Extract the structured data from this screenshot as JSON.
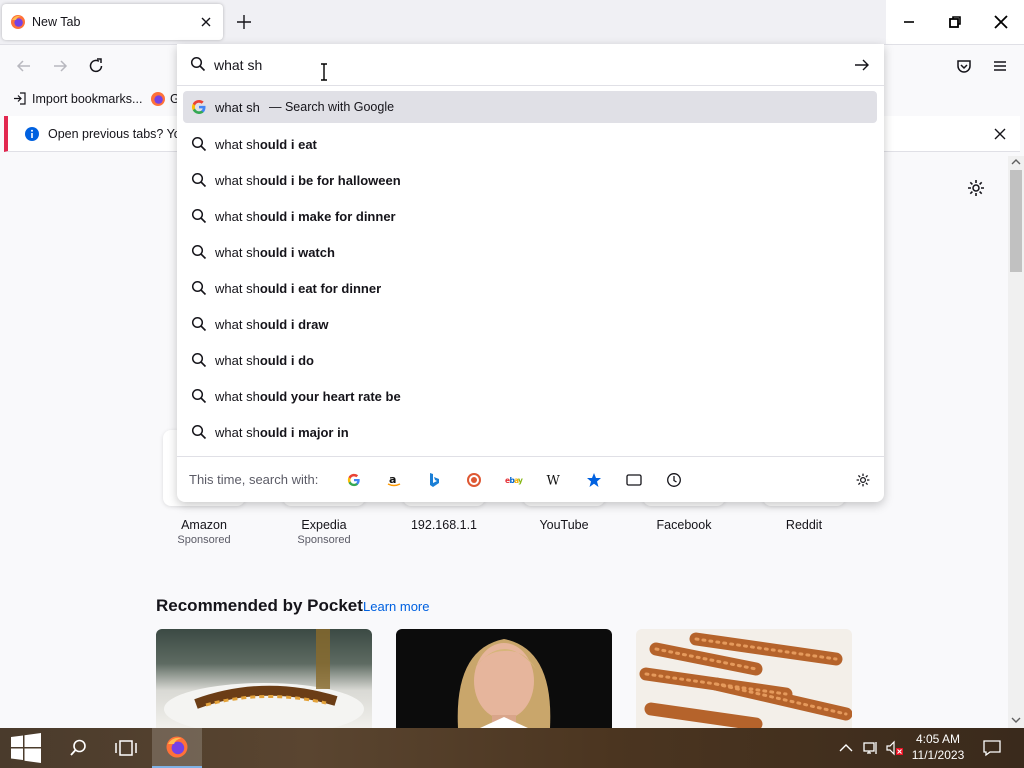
{
  "browser": {
    "tab_title": "New Tab",
    "bookmarks": [
      "Import bookmarks...",
      "G"
    ],
    "notification": "Open previous tabs? You"
  },
  "urlbar": {
    "value": "what sh",
    "google_query": "what sh",
    "google_suffix": "— Search with Google",
    "suggestions": [
      {
        "typed": "what sh",
        "rest": "ould i eat"
      },
      {
        "typed": "what sh",
        "rest": "ould i be for halloween"
      },
      {
        "typed": "what sh",
        "rest": "ould i make for dinner"
      },
      {
        "typed": "what sh",
        "rest": "ould i watch"
      },
      {
        "typed": "what sh",
        "rest": "ould i eat for dinner"
      },
      {
        "typed": "what sh",
        "rest": "ould i draw"
      },
      {
        "typed": "what sh",
        "rest": "ould i do"
      },
      {
        "typed": "what sh",
        "rest": "ould your heart rate be"
      },
      {
        "typed": "what sh",
        "rest": "ould i major in"
      }
    ],
    "search_with_label": "This time, search with:",
    "engines": [
      "google-icon",
      "amazon-icon",
      "bing-icon",
      "duckduckgo-icon",
      "ebay-icon",
      "wikipedia-icon",
      "bookmarks-icon",
      "tabs-icon",
      "history-icon"
    ]
  },
  "shortcuts": [
    {
      "label": "Amazon",
      "sponsored": "Sponsored"
    },
    {
      "label": "Expedia",
      "sponsored": "Sponsored"
    },
    {
      "label": "192.168.1.1",
      "sponsored": ""
    },
    {
      "label": "YouTube",
      "sponsored": ""
    },
    {
      "label": "Facebook",
      "sponsored": ""
    },
    {
      "label": "Reddit",
      "sponsored": ""
    }
  ],
  "pocket": {
    "heading": "Recommended by Pocket",
    "learn_more": "Learn more"
  },
  "taskbar": {
    "time": "4:05 AM",
    "date": "11/1/2023"
  },
  "colors": {
    "accent": "#0061e0",
    "notification_bar": "#e22850",
    "highlight": "#e0e0e6"
  }
}
